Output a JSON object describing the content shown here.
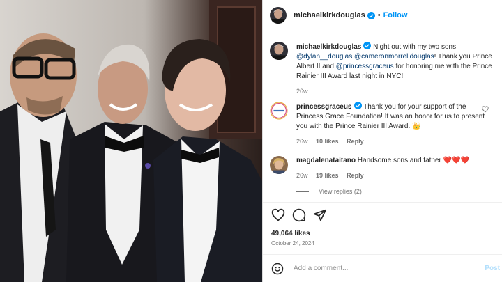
{
  "post": {
    "author": "michaelkirkdouglas",
    "follow_label": "Follow",
    "separator": "•",
    "more_label": "···"
  },
  "caption": {
    "username": "michaelkirkdouglas",
    "text_1": " Night out with my two sons ",
    "mention_1": "@dylan__douglas",
    "text_2": " ",
    "mention_2": "@cameronmorrelldouglas",
    "text_3": "! Thank you Prince Albert II and ",
    "mention_3": "@princessgraceus",
    "text_4": " for honoring me with the Prince Rainier III Award last night in NYC!",
    "time": "26w"
  },
  "comments": [
    {
      "username": "princessgraceus",
      "text": " Thank you for your support of the Princess Grace Foundation! It was an honor for us to present you with the Prince Rainier III Award. 👑",
      "time": "26w",
      "likes": "10 likes",
      "reply": "Reply"
    },
    {
      "username": "magdalenataitano",
      "text": " Handsome sons and father ❤️❤️❤️",
      "time": "26w",
      "likes": "19 likes",
      "reply": "Reply"
    }
  ],
  "view_replies": "View replies (2)",
  "likes_count": "49,064 likes",
  "date": "October 24, 2024",
  "add_comment_placeholder": "Add a comment...",
  "post_label": "Post",
  "icons": {
    "like": "heart-icon",
    "comment": "comment-icon",
    "share": "share-icon",
    "save": "bookmark-icon",
    "emoji": "emoji-icon"
  },
  "colors": {
    "accent": "#0095f6",
    "verified": "#0095f6",
    "mention": "#00376b"
  }
}
